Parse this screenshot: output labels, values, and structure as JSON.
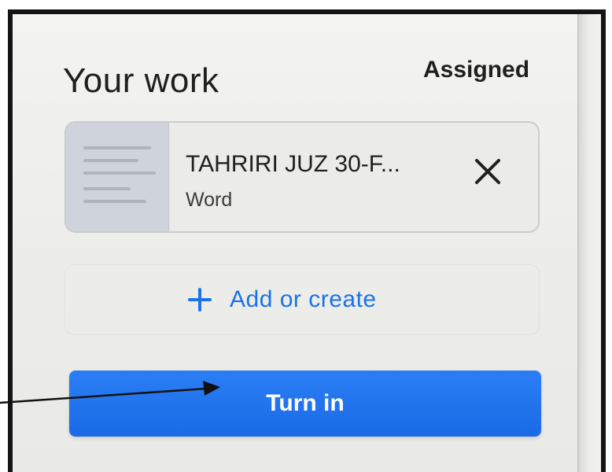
{
  "header": {
    "title": "Your work",
    "status": "Assigned"
  },
  "attachment": {
    "file_name": "TAHRIRI JUZ 30-F...",
    "file_type": "Word",
    "remove_icon": "close-icon"
  },
  "add": {
    "label": "Add or create",
    "icon": "plus-icon"
  },
  "turn_in": {
    "label": "Turn in"
  },
  "colors": {
    "accent": "#1a73e8",
    "button": "#1a6ae6",
    "frame": "#141414"
  }
}
